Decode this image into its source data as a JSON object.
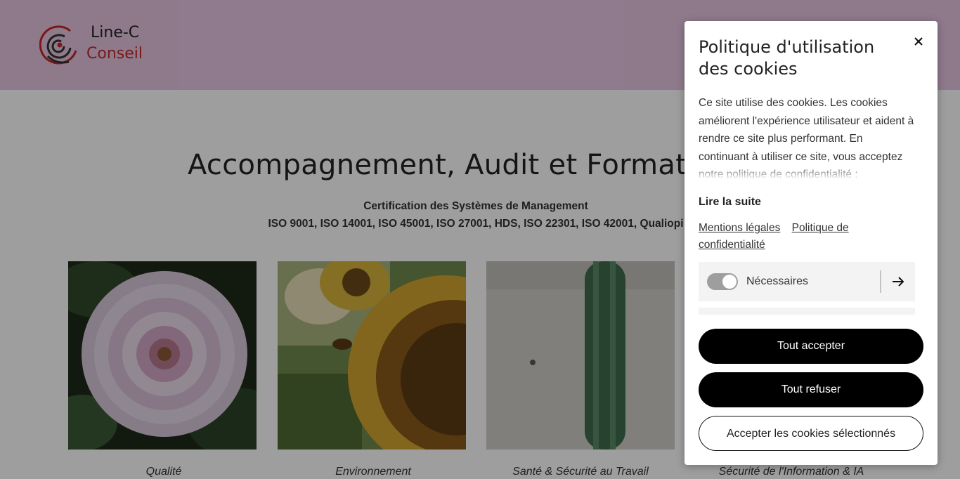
{
  "header": {
    "logo_line1": "Line-C",
    "logo_line2": "Conseil"
  },
  "hero": {
    "title": "Accompagnement, Audit et Formation",
    "subtitle_line1": "Certification des Systèmes de Management",
    "subtitle_line2": "ISO 9001, ISO 14001, ISO 45001, ISO 27001, HDS, ISO 22301, ISO 42001, Qualiopi"
  },
  "cards": [
    {
      "label": "Qualité",
      "image": "dahlia-flower"
    },
    {
      "label": "Environnement",
      "image": "sunflower-with-bee"
    },
    {
      "label": "Santé & Sécurité au Travail",
      "image": "cactus"
    },
    {
      "label": "Sécurité de l'Information & IA",
      "image": ""
    }
  ],
  "cookie_modal": {
    "title": "Politique d'utilisation des cookies",
    "close_icon": "close-icon",
    "body": "Ce site utilise des cookies. Les cookies améliorent l'expérience utilisateur et aident à rendre ce site plus performant. En continuant à utiliser ce site, vous acceptez notre politique de confidentialité :",
    "read_more": "Lire la suite",
    "links": [
      "Mentions légales",
      "Politique de confidentialité"
    ],
    "categories": [
      {
        "label": "Nécessaires",
        "enabled": true,
        "arrow_icon": "arrow-right-icon"
      }
    ],
    "accept_all": "Tout accepter",
    "reject_all": "Tout refuser",
    "accept_selected": "Accepter les cookies sélectionnés"
  },
  "colors": {
    "header_bg": "#e7c6e3",
    "brand_red": "#c62828",
    "overlay": "rgba(0,0,0,0.38)",
    "button_dark": "#000000"
  }
}
